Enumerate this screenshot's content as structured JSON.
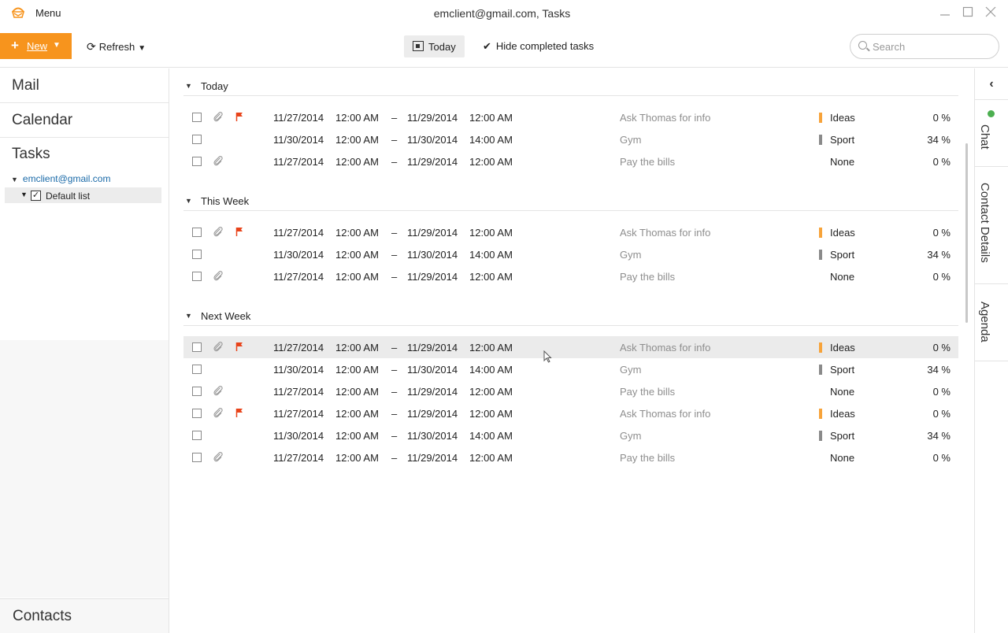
{
  "app": {
    "menu_label": "Menu",
    "window_title": "emclient@gmail.com, Tasks",
    "window_buttons": [
      "minimize-icon",
      "maximize-icon",
      "close-icon"
    ]
  },
  "toolbar": {
    "new_label": "New",
    "refresh_label": "Refresh",
    "today_label": "Today",
    "hide_completed_label": "Hide completed tasks",
    "search_placeholder": "Search"
  },
  "sidebar": {
    "mail": "Mail",
    "calendar": "Calendar",
    "tasks": "Tasks",
    "account": "emclient@gmail.com",
    "list": "Default list",
    "contacts": "Contacts"
  },
  "right_panel": {
    "tabs": [
      "Chat",
      "Contact Details",
      "Agenda"
    ]
  },
  "colors": {
    "accent": "#f7941d",
    "flag": "#e8431a",
    "ideas": "#f7a33a",
    "sport": "#8a8a8a",
    "online": "#4caf50"
  },
  "groups": [
    {
      "label": "Today",
      "rows": [
        {
          "attachment": true,
          "flag": true,
          "start_date": "11/27/2014",
          "start_time": "12:00 AM",
          "dash": "–",
          "end_date": "11/29/2014",
          "end_time": "12:00 AM",
          "subject": "Ask Thomas for info",
          "category": "Ideas",
          "category_color": "#f7a33a",
          "percent": "0 %"
        },
        {
          "attachment": false,
          "flag": false,
          "start_date": "11/30/2014",
          "start_time": "12:00 AM",
          "dash": "–",
          "end_date": "11/30/2014",
          "end_time": "14:00 AM",
          "subject": "Gym",
          "category": "Sport",
          "category_color": "#8a8a8a",
          "percent": "34 %"
        },
        {
          "attachment": true,
          "flag": false,
          "start_date": "11/27/2014",
          "start_time": "12:00 AM",
          "dash": "–",
          "end_date": "11/29/2014",
          "end_time": "12:00 AM",
          "subject": "Pay the bills",
          "category": "None",
          "category_color": "",
          "percent": "0 %"
        }
      ]
    },
    {
      "label": "This Week",
      "rows": [
        {
          "attachment": true,
          "flag": true,
          "start_date": "11/27/2014",
          "start_time": "12:00 AM",
          "dash": "–",
          "end_date": "11/29/2014",
          "end_time": "12:00 AM",
          "subject": "Ask Thomas for info",
          "category": "Ideas",
          "category_color": "#f7a33a",
          "percent": "0 %"
        },
        {
          "attachment": false,
          "flag": false,
          "start_date": "11/30/2014",
          "start_time": "12:00 AM",
          "dash": "–",
          "end_date": "11/30/2014",
          "end_time": "14:00 AM",
          "subject": "Gym",
          "category": "Sport",
          "category_color": "#8a8a8a",
          "percent": "34 %"
        },
        {
          "attachment": true,
          "flag": false,
          "start_date": "11/27/2014",
          "start_time": "12:00 AM",
          "dash": "–",
          "end_date": "11/29/2014",
          "end_time": "12:00 AM",
          "subject": "Pay the bills",
          "category": "None",
          "category_color": "",
          "percent": "0 %"
        }
      ]
    },
    {
      "label": "Next Week",
      "rows": [
        {
          "attachment": true,
          "flag": true,
          "highlighted": true,
          "start_date": "11/27/2014",
          "start_time": "12:00 AM",
          "dash": "–",
          "end_date": "11/29/2014",
          "end_time": "12:00 AM",
          "subject": "Ask Thomas for info",
          "category": "Ideas",
          "category_color": "#f7a33a",
          "percent": "0 %"
        },
        {
          "attachment": false,
          "flag": false,
          "start_date": "11/30/2014",
          "start_time": "12:00 AM",
          "dash": "–",
          "end_date": "11/30/2014",
          "end_time": "14:00 AM",
          "subject": "Gym",
          "category": "Sport",
          "category_color": "#8a8a8a",
          "percent": "34 %"
        },
        {
          "attachment": true,
          "flag": false,
          "start_date": "11/27/2014",
          "start_time": "12:00 AM",
          "dash": "–",
          "end_date": "11/29/2014",
          "end_time": "12:00 AM",
          "subject": "Pay the bills",
          "category": "None",
          "category_color": "",
          "percent": "0 %"
        },
        {
          "attachment": true,
          "flag": true,
          "start_date": "11/27/2014",
          "start_time": "12:00 AM",
          "dash": "–",
          "end_date": "11/29/2014",
          "end_time": "12:00 AM",
          "subject": "Ask Thomas for info",
          "category": "Ideas",
          "category_color": "#f7a33a",
          "percent": "0 %"
        },
        {
          "attachment": false,
          "flag": false,
          "start_date": "11/30/2014",
          "start_time": "12:00 AM",
          "dash": "–",
          "end_date": "11/30/2014",
          "end_time": "14:00 AM",
          "subject": "Gym",
          "category": "Sport",
          "category_color": "#8a8a8a",
          "percent": "34 %"
        },
        {
          "attachment": true,
          "flag": false,
          "start_date": "11/27/2014",
          "start_time": "12:00 AM",
          "dash": "–",
          "end_date": "11/29/2014",
          "end_time": "12:00 AM",
          "subject": "Pay the bills",
          "category": "None",
          "category_color": "",
          "percent": "0 %"
        }
      ]
    }
  ]
}
